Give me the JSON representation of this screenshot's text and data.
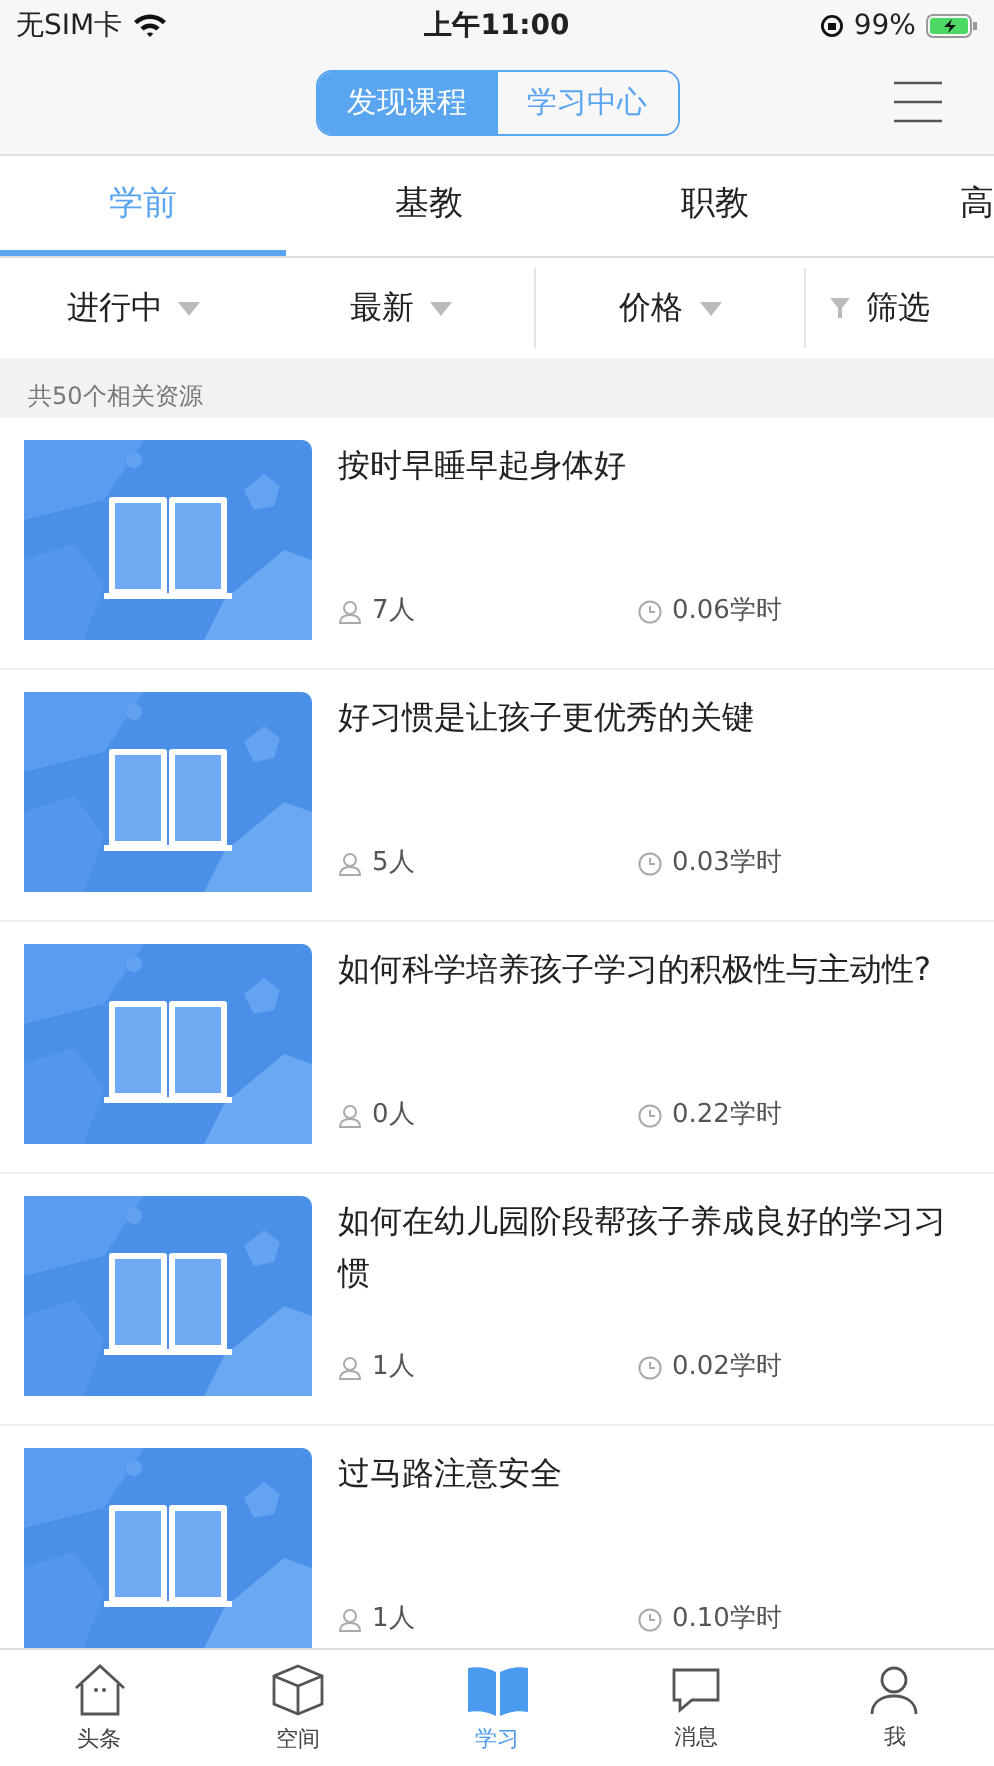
{
  "status_bar": {
    "carrier": "无SIM卡",
    "time": "上午11:00",
    "battery": "99%"
  },
  "header": {
    "segments": [
      {
        "label": "发现课程",
        "selected": true
      },
      {
        "label": "学习中心",
        "selected": false
      }
    ]
  },
  "tabs": [
    {
      "label": "学前",
      "selected": true
    },
    {
      "label": "基教",
      "selected": false
    },
    {
      "label": "职教",
      "selected": false
    },
    {
      "label": "高",
      "selected": false
    }
  ],
  "filters": [
    {
      "label": "进行中",
      "kind": "dropdown"
    },
    {
      "label": "最新",
      "kind": "dropdown"
    },
    {
      "label": "价格",
      "kind": "dropdown"
    },
    {
      "label": "筛选",
      "kind": "filter"
    }
  ],
  "result_count": "共50个相关资源",
  "courses": [
    {
      "title": "按时早睡早起身体好",
      "learners": "7人",
      "hours": "0.06学时"
    },
    {
      "title": "好习惯是让孩子更优秀的关键",
      "learners": "5人",
      "hours": "0.03学时"
    },
    {
      "title": "如何科学培养孩子学习的积极性与主动性?",
      "learners": "0人",
      "hours": "0.22学时"
    },
    {
      "title": "如何在幼儿园阶段帮孩子养成良好的学习习惯",
      "learners": "1人",
      "hours": "0.02学时"
    },
    {
      "title": "过马路注意安全",
      "learners": "1人",
      "hours": "0.10学时"
    }
  ],
  "bottom_nav": [
    {
      "label": "头条",
      "kind": "home",
      "selected": false
    },
    {
      "label": "空间",
      "kind": "cube",
      "selected": false
    },
    {
      "label": "学习",
      "kind": "book",
      "selected": true
    },
    {
      "label": "消息",
      "kind": "chat",
      "selected": false
    },
    {
      "label": "我",
      "kind": "person",
      "selected": false
    }
  ]
}
